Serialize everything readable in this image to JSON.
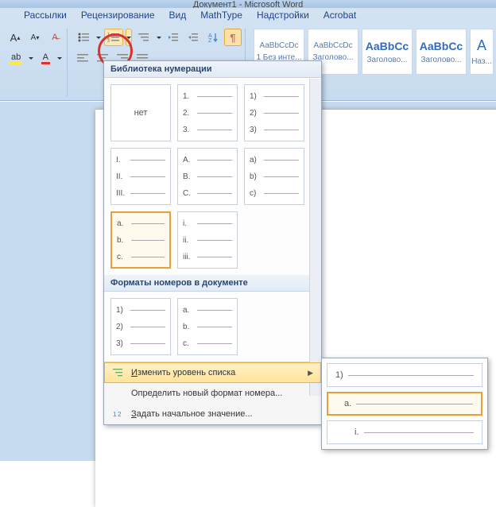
{
  "title": "Документ1 - Microsoft Word",
  "tabs": [
    "Рассылки",
    "Рецензирование",
    "Вид",
    "MathType",
    "Надстройки",
    "Acrobat"
  ],
  "styles": [
    {
      "sample": "AaBbCcDc",
      "label": "1 Без инте..."
    },
    {
      "sample": "AaBbCcDc",
      "label": "Заголово..."
    },
    {
      "sample": "AaBbCc",
      "label": "Заголово...",
      "blue": true
    },
    {
      "sample": "AaBbCc",
      "label": "Заголово...",
      "blue": true
    },
    {
      "sample": "A",
      "label": "Наз..."
    }
  ],
  "dropdown": {
    "section1_title": "Библиотека нумерации",
    "section2_title": "Форматы номеров в документе",
    "gallery1": [
      {
        "none": true,
        "label": "нет"
      },
      {
        "rows": [
          "1.",
          "2.",
          "3."
        ]
      },
      {
        "rows": [
          "1)",
          "2)",
          "3)"
        ]
      },
      {
        "rows": [
          "I.",
          "II.",
          "III."
        ]
      },
      {
        "rows": [
          "A.",
          "B.",
          "C."
        ]
      },
      {
        "rows": [
          "a)",
          "b)",
          "c)"
        ]
      },
      {
        "rows": [
          "a.",
          "b.",
          "c."
        ],
        "selected": true
      },
      {
        "rows": [
          "i.",
          "ii.",
          "iii."
        ]
      }
    ],
    "gallery2": [
      {
        "rows": [
          "1)",
          "2)",
          "3)"
        ]
      },
      {
        "rows": [
          "a.",
          "b.",
          "c."
        ]
      }
    ],
    "menu": {
      "change_level": "Изменить уровень списка",
      "define_new": "Определить новый формат номера...",
      "set_start": "Задать начальное значение..."
    }
  },
  "submenu": [
    {
      "label": "1)"
    },
    {
      "label": "a.",
      "selected": true,
      "indent": 1
    },
    {
      "label": "i.",
      "indent": 2
    }
  ]
}
